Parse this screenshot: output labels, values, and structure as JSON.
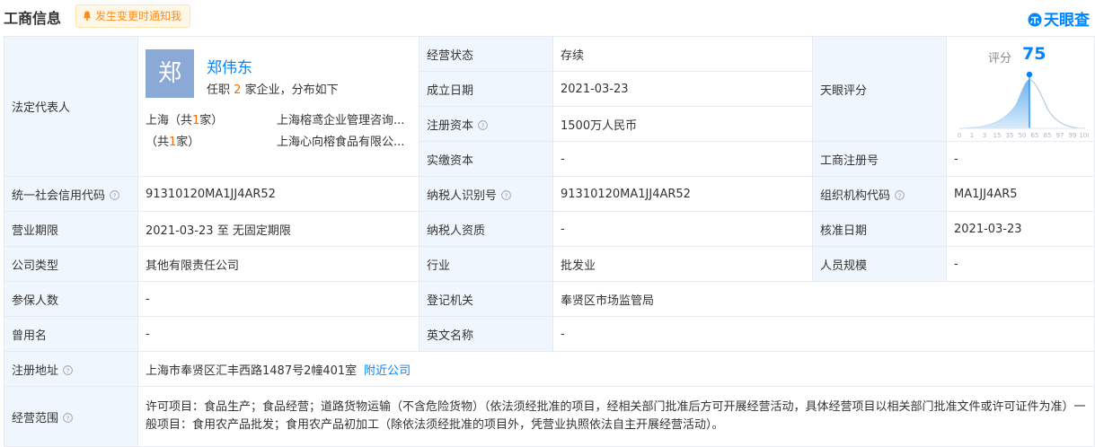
{
  "header": {
    "title": "工商信息",
    "notify_label": "发生变更时通知我",
    "logo_text": "天眼查",
    "accent_color": "#0084ff"
  },
  "legal": {
    "label": "法定代表人",
    "avatar_char": "郑",
    "name": "郑伟东",
    "sub_prefix": "任职",
    "sub_count": "2",
    "sub_suffix": "家企业，分布如下",
    "distribution": [
      {
        "region": "上海（共",
        "count": "1",
        "region_suffix": "家）",
        "company": "上海榕鸢企业管理咨询..."
      },
      {
        "region": "（共",
        "count": "1",
        "region_suffix": "家）",
        "company": "上海心向榕食品有限公..."
      }
    ]
  },
  "fields": {
    "status_label": "经营状态",
    "status_value": "存续",
    "founded_label": "成立日期",
    "founded_value": "2021-03-23",
    "reg_capital_label": "注册资本",
    "reg_capital_value": "1500万人民币",
    "paid_capital_label": "实缴资本",
    "paid_capital_value": "-",
    "score_label": "天眼评分",
    "biz_reg_no_label": "工商注册号",
    "biz_reg_no_value": "-",
    "credit_code_label": "统一社会信用代码",
    "credit_code_value": "91310120MA1JJ4AR52",
    "taxpayer_id_label": "纳税人识别号",
    "taxpayer_id_value": "91310120MA1JJ4AR52",
    "org_code_label": "组织机构代码",
    "org_code_value": "MA1JJ4AR5",
    "term_label": "营业期限",
    "term_start": "2021-03-23",
    "term_to": "至",
    "term_end": "无固定期限",
    "taxpayer_qual_label": "纳税人资质",
    "taxpayer_qual_value": "-",
    "approve_date_label": "核准日期",
    "approve_date_value": "2021-03-23",
    "company_type_label": "公司类型",
    "company_type_value": "其他有限责任公司",
    "industry_label": "行业",
    "industry_value": "批发业",
    "staff_size_label": "人员规模",
    "staff_size_value": "-",
    "insured_label": "参保人数",
    "insured_value": "-",
    "reg_authority_label": "登记机关",
    "reg_authority_value": "奉贤区市场监管局",
    "former_name_label": "曾用名",
    "former_name_value": "-",
    "english_name_label": "英文名称",
    "english_name_value": "-",
    "address_label": "注册地址",
    "address_value": "上海市奉贤区汇丰西路1487号2幢401室",
    "address_link": "附近公司",
    "scope_label": "经营范围",
    "scope_value": "许可项目：食品生产；食品经营；道路货物运输（不含危险货物）（依法须经批准的项目，经相关部门批准后方可开展经营活动，具体经营项目以相关部门批准文件或许可证件为准）一般项目：食用农产品批发；食用农产品初加工（除依法须经批准的项目外，凭营业执照依法自主开展经营活动）。"
  },
  "score": {
    "label": "评分",
    "value": "75",
    "value_num": 75,
    "ticks": [
      "0",
      "1",
      "3",
      "15",
      "35",
      "50",
      "65",
      "85",
      "97",
      "99",
      "100"
    ]
  }
}
